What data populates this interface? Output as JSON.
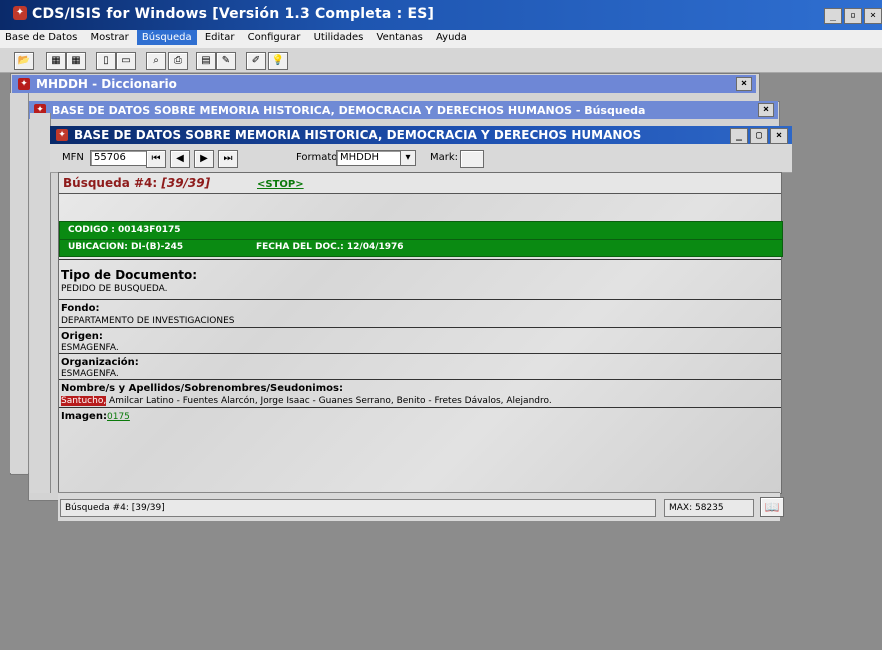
{
  "app": {
    "title": "CDS/ISIS for Windows [Versión 1.3 Completa : ES]"
  },
  "menu": {
    "items": [
      "Base de Datos",
      "Mostrar",
      "Búsqueda",
      "Editar",
      "Configurar",
      "Utilidades",
      "Ventanas",
      "Ayuda"
    ],
    "active": "Búsqueda"
  },
  "toolbar": {
    "buttons": [
      {
        "icon": "open-folder-icon",
        "label": ""
      },
      {
        "icon": "db-icon",
        "label": ""
      },
      {
        "icon": "dbs-icon",
        "label": ""
      },
      {
        "icon": "page-icon",
        "label": ""
      },
      {
        "icon": "page-icon",
        "label": ""
      },
      {
        "icon": "search-icon",
        "label": ""
      },
      {
        "icon": "print-icon",
        "label": ""
      },
      {
        "icon": "window-icon",
        "label": ""
      },
      {
        "icon": "edit-icon",
        "label": ""
      },
      {
        "icon": "pencil-icon",
        "label": ""
      },
      {
        "icon": "lightbulb-icon",
        "label": ""
      }
    ]
  },
  "windows": {
    "dictionary_title": "MHDDH - Diccionario",
    "search_window_title": "BASE DE DATOS SOBRE MEMORIA HISTORICA, DEMOCRACIA Y DERECHOS HUMANOS - Búsqueda",
    "main_window_title": "BASE DE DATOS SOBRE MEMORIA HISTORICA, DEMOCRACIA Y DERECHOS HUMANOS"
  },
  "main": {
    "mfn_label": "MFN",
    "mfn_value": "55706",
    "formato_label": "Formato:",
    "formato_value": "MHDDH",
    "mark_label": "Mark:",
    "search_title_prefix": "Búsqueda #4: ",
    "search_title_range": "[39/39]",
    "stop_link": "<STOP>",
    "record": {
      "codigo_line": "CODIGO   : 00143F0175",
      "ubicacion_line": "UBICACION: DI-(B)-245",
      "fecha_line": "FECHA DEL DOC.: 12/04/1976",
      "tipo_label": "Tipo de Documento:",
      "tipo_value": "PEDIDO DE BUSQUEDA.",
      "fondo_label": "Fondo:",
      "fondo_value": "DEPARTAMENTO DE INVESTIGACIONES",
      "origen_label": "Origen:",
      "origen_value": "ESMAGENFA.",
      "org_label": "Organización:",
      "org_value": "ESMAGENFA.",
      "names_label": "Nombre/s y Apellidos/Sobrenombres/Seudonimos:",
      "names_highlight": "Santucho,",
      "names_rest": " Amilcar Latino  -  Fuentes Alarcón, Jorge Isaac  -  Guanes Serrano, Benito  -  Fretes Dávalos, Alejandro.",
      "imagen_label": "Imagen:",
      "imagen_value": "0175"
    },
    "status_left": "Búsqueda #4: [39/39]",
    "status_max": "MAX: 58235"
  }
}
